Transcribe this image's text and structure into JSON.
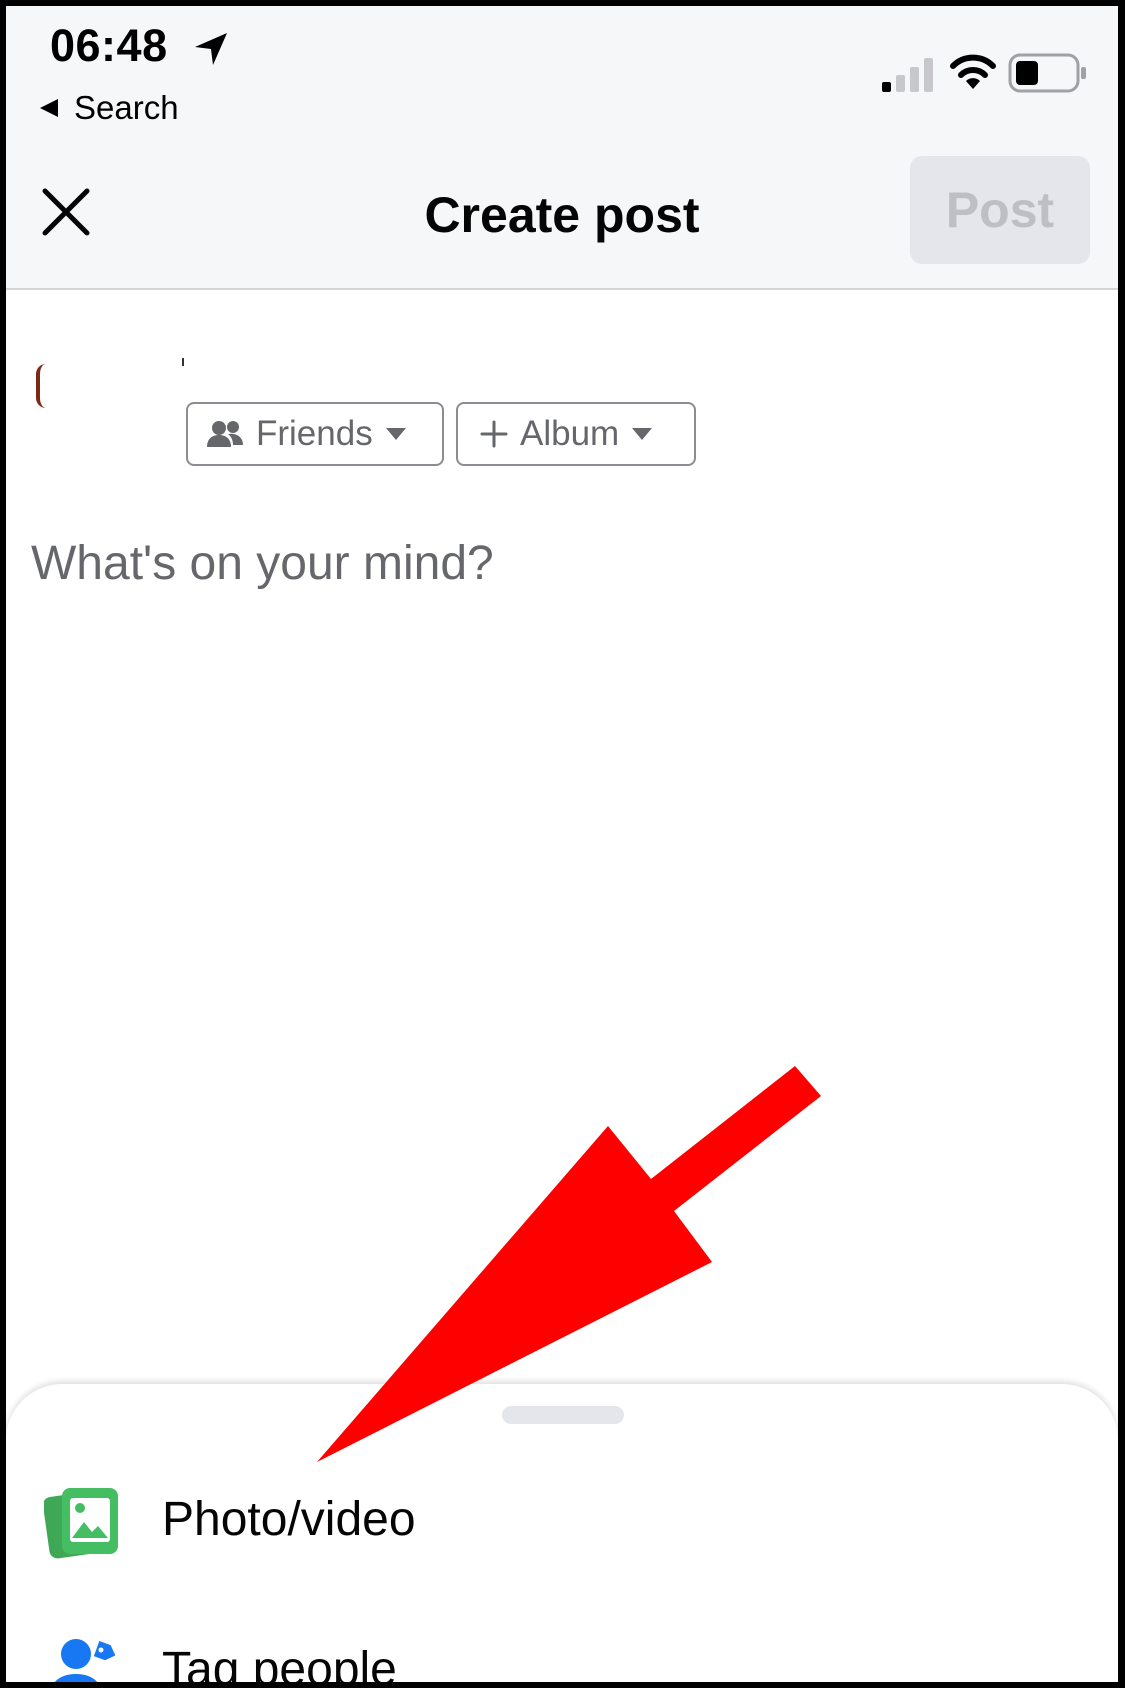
{
  "status_bar": {
    "time": "06:48",
    "back_label": "Search"
  },
  "header": {
    "title": "Create post",
    "post_label": "Post"
  },
  "composer": {
    "audience_label": "Friends",
    "album_label": "Album",
    "placeholder": "What's on your mind?"
  },
  "sheet": {
    "actions": [
      {
        "label": "Photo/video",
        "icon": "photo-video-icon"
      },
      {
        "label": "Tag people",
        "icon": "tag-people-icon"
      }
    ]
  },
  "colors": {
    "photo_green": "#45bd62",
    "tag_blue": "#1877f2",
    "annotation_red": "#ff0000",
    "post_disabled_bg": "#e4e6eb"
  }
}
